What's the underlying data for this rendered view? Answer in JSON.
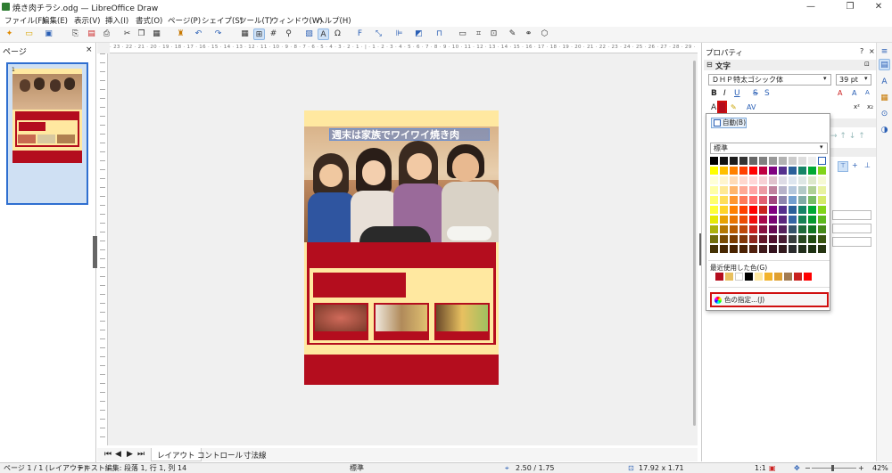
{
  "app": {
    "title": "焼き肉チラシ.odg — LibreOffice Draw"
  },
  "menu": [
    "ファイル(F)",
    "編集(E)",
    "表示(V)",
    "挿入(I)",
    "書式(O)",
    "ページ(P)",
    "シェイプ(S)",
    "ツール(T)",
    "ウィンドウ(W)",
    "ヘルプ(H)"
  ],
  "pages_panel": {
    "title": "ページ",
    "close": "×",
    "page_number": "1"
  },
  "ruler": {
    "h": "· 23 · 22 · 21 · 20 · 19 · 18 · 17 · 16 · 15 · 14 · 13 · 12 · 11 · 10 · 9 · 8 · 7 · 6 · 5 · 4 · 3 · 2 · 1 · | · 1 · 2 · 3 · 4 · 5 · 6 · 7 · 8 · 9 · 10 · 11 · 12 · 13 · 14 · 15 · 16 · 17 · 18 · 19 · 20 · 21 · 22 · 23 · 24 · 25 · 26 · 27 · 28 · 29 · 30 · 31 · 32 · 33 · 34 · 35 · 36 · 37 · 38 · 39 · 40 · 41 · 42 · 43"
  },
  "doc": {
    "headline": "週末は家族でワイワイ焼き肉"
  },
  "tabs": [
    "レイアウト",
    "コントロール",
    "寸法線"
  ],
  "sidebar": {
    "title": "プロパティ",
    "section_text": "文字",
    "font_name": "ＤＨＰ特太ゴシック体",
    "font_size": "39 pt"
  },
  "color_popup": {
    "auto_label": "自動(B)",
    "palette": "標準",
    "recent_label": "最近使用した色(G)",
    "custom_label": "色の指定...(J)"
  },
  "palette_colors": [
    [
      "#000000",
      "#111111",
      "#1c1c1c",
      "#333333",
      "#666666",
      "#808080",
      "#999999",
      "#b2b2b2",
      "#cccccc",
      "#dddddd",
      "#eeeeee",
      "#ffffff"
    ],
    [
      "#ffff00",
      "#ffbf00",
      "#ff8000",
      "#ff4000",
      "#ff0000",
      "#bf0041",
      "#800080",
      "#55308d",
      "#2a6099",
      "#158466",
      "#00a933",
      "#81d41a"
    ],
    [
      "#ffffd7",
      "#fff5ce",
      "#ffdbb6",
      "#ffd8ce",
      "#ffd7d7",
      "#f7d1d5",
      "#e0c2cd",
      "#dedce6",
      "#dee6ef",
      "#dee7e5",
      "#dde8cb",
      "#f6f9d4"
    ],
    [
      "#ffffa6",
      "#ffe994",
      "#ffb66c",
      "#ffaa95",
      "#ffa6a6",
      "#ec9ba4",
      "#bf819e",
      "#b7b3ca",
      "#b4c7dc",
      "#b3cac7",
      "#afd095",
      "#e8f2a1"
    ],
    [
      "#ffff6d",
      "#ffde59",
      "#ff972f",
      "#ff7b59",
      "#ff6d6d",
      "#e16173",
      "#a1467e",
      "#8e86ae",
      "#729fcf",
      "#81aca6",
      "#77bc65",
      "#d4ea6b"
    ],
    [
      "#ffff38",
      "#ffd428",
      "#ff8000",
      "#ff4000",
      "#ff0000",
      "#c9211e",
      "#800080",
      "#55308d",
      "#2a6099",
      "#158466",
      "#00a933",
      "#81d41a"
    ],
    [
      "#e6e905",
      "#e8a202",
      "#ea7500",
      "#ed4c05",
      "#f10d0c",
      "#a7074b",
      "#780373",
      "#5b277d",
      "#3465a4",
      "#168253",
      "#069a2e",
      "#5eb91e"
    ],
    [
      "#acb20c",
      "#b47804",
      "#b85c00",
      "#be480a",
      "#c9211e",
      "#861141",
      "#650953",
      "#55215b",
      "#355269",
      "#1e6a39",
      "#127622",
      "#468a1a"
    ],
    [
      "#706e0c",
      "#784b04",
      "#7b3d00",
      "#813709",
      "#8d281e",
      "#611729",
      "#4e102d",
      "#481d32",
      "#383d3c",
      "#28471f",
      "#224b12",
      "#395511"
    ],
    [
      "#443205",
      "#472702",
      "#492300",
      "#4b2204",
      "#50200e",
      "#3e1a1b",
      "#34131e",
      "#321a1d",
      "#2a2b2c",
      "#212d1a",
      "#1e3112",
      "#263512"
    ]
  ],
  "recent_colors": [
    "#b40d1e",
    "#e8c060",
    "#ffffff",
    "#000000",
    "#ffe8a0",
    "#f2b32b",
    "#e0a030",
    "#a37b50",
    "#c9211e",
    "#ff0000"
  ],
  "status": {
    "page": "ページ 1 / 1 (レイアウト)",
    "edit": "テキスト編集: 段落 1, 行 1, 列 14",
    "style": "標準",
    "pos": "2.50 / 1.75",
    "size": "17.92 x 1.71",
    "scale": "1:1",
    "zoom": "42%"
  }
}
